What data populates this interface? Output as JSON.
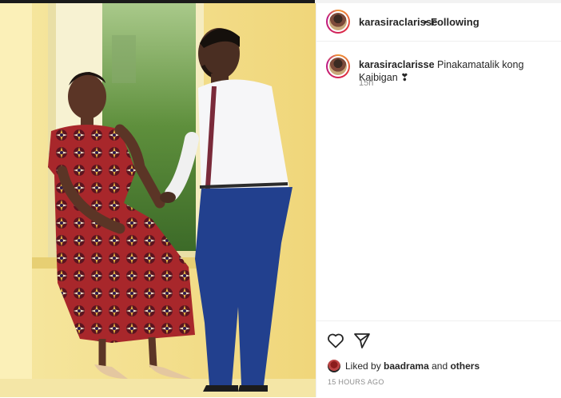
{
  "colors": {
    "accent": "#262626",
    "muted": "#8e8e8e",
    "divider": "#efefef",
    "story_ring": "#dc2743"
  },
  "photo": {
    "description_icon": "couple-photo"
  },
  "header": {
    "username": "karasiraclarisse",
    "separator": "•",
    "follow_status": "Following"
  },
  "caption": {
    "username": "karasiraclarisse",
    "text": "Pinakamatalik kong Kaibigan ❣",
    "time": "15h"
  },
  "actions": {
    "like_icon": "heart-icon",
    "share_icon": "send-icon"
  },
  "likes": {
    "prefix": "Liked by",
    "user": "baadrama",
    "middle": "and",
    "others": "others"
  },
  "timestamp": "15 HOURS AGO"
}
